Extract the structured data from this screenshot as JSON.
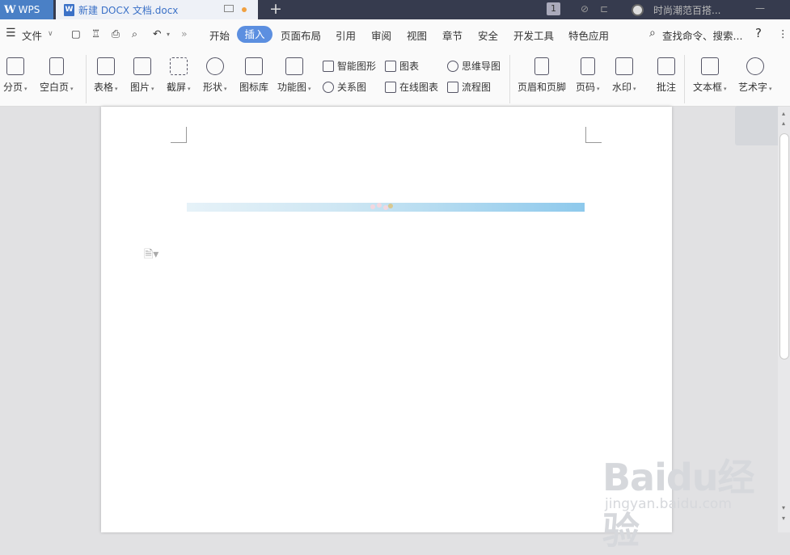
{
  "titlebar": {
    "app_name": "WPS",
    "app_logo": "W",
    "doc_tab_title": "新建 DOCX 文档.docx",
    "doc_icon": "W",
    "new_tab": "+",
    "badge": "1",
    "account_name": "时尚潮范百搭..."
  },
  "menubar": {
    "file_menu": "文件",
    "tabs": [
      "开始",
      "插入",
      "页面布局",
      "引用",
      "审阅",
      "视图",
      "章节",
      "安全",
      "开发工具",
      "特色应用"
    ],
    "search_placeholder": "查找命令、搜索...",
    "help": "?"
  },
  "ribbon": {
    "page_break": "分页",
    "blank_page": "空白页",
    "table": "表格",
    "picture": "图片",
    "screenshot": "截屏",
    "shapes": "形状",
    "icon_library": "图标库",
    "function_chart": "功能图",
    "smart_shape": "智能图形",
    "chart": "图表",
    "mind_map": "思维导图",
    "relation_chart": "关系图",
    "online_chart": "在线图表",
    "flowchart": "流程图",
    "header_footer": "页眉和页脚",
    "page_number": "页码",
    "watermark": "水印",
    "comment": "批注",
    "text_box": "文本框",
    "word_art": "艺术字"
  },
  "watermark": {
    "brand": "Baidu经验",
    "url": "jingyan.baidu.com"
  },
  "colors": {
    "titlebar_bg": "#363b4e",
    "accent": "#5c8fe0",
    "doc_tab_text": "#3b71c7"
  }
}
